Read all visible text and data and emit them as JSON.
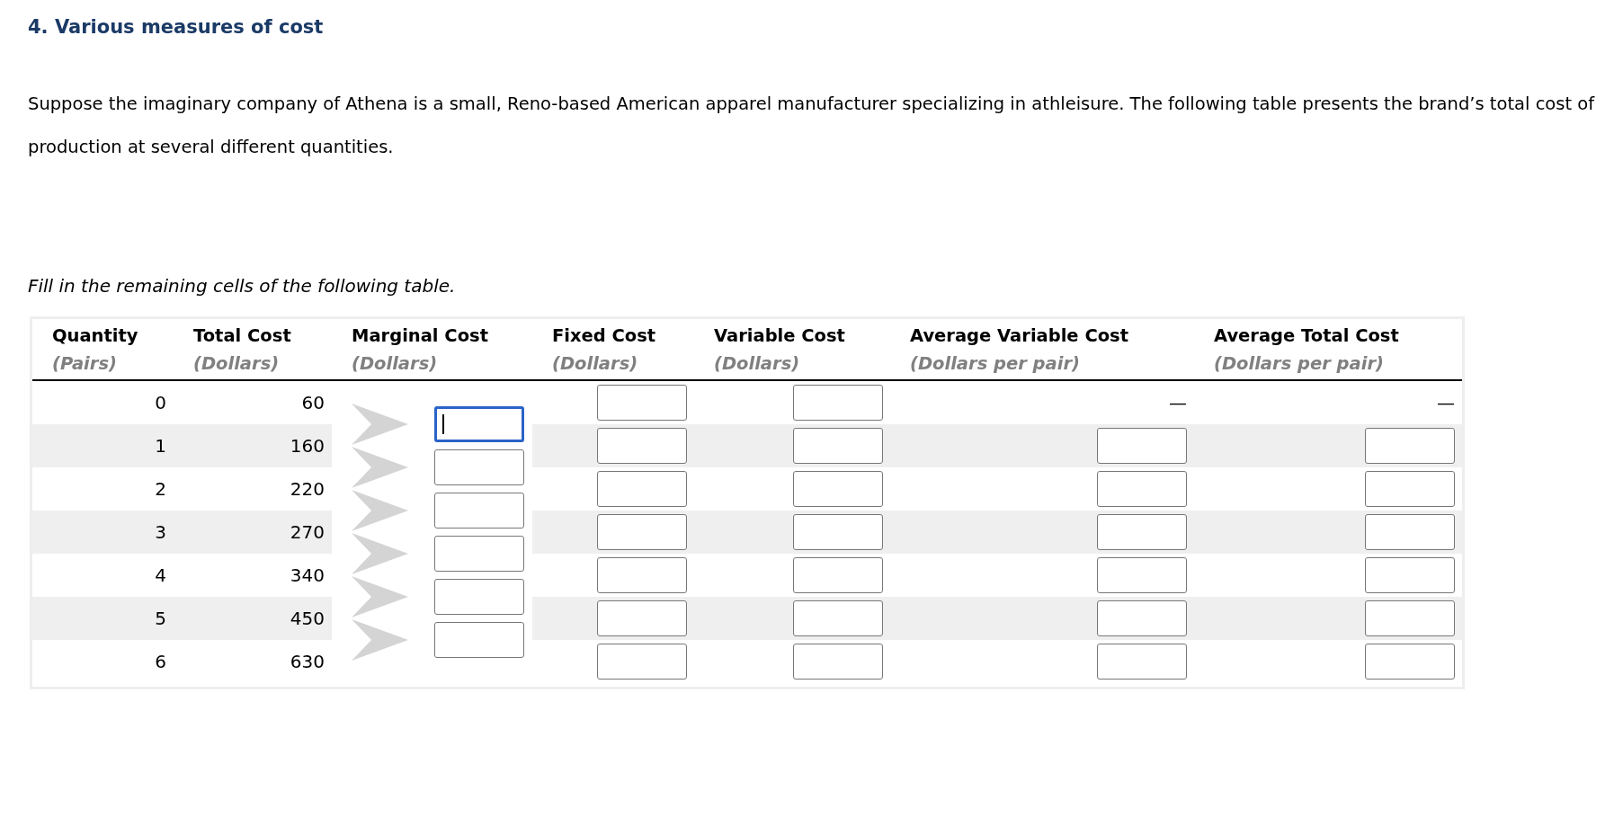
{
  "title": "4. Various measures of cost",
  "intro": "Suppose the imaginary company of Athena is a small, Reno-based American apparel manufacturer specializing in athleisure. The following table presents the brand’s total cost of production at several different quantities.",
  "instruction": "Fill in the remaining cells of the following table.",
  "table": {
    "columns": [
      {
        "title": "Quantity",
        "unit": "(Pairs)"
      },
      {
        "title": "Total Cost",
        "unit": "(Dollars)"
      },
      {
        "title": "Marginal Cost",
        "unit": "(Dollars)"
      },
      {
        "title": "Fixed Cost",
        "unit": "(Dollars)"
      },
      {
        "title": "Variable Cost",
        "unit": "(Dollars)"
      },
      {
        "title": "Average Variable Cost",
        "unit": "(Dollars per pair)"
      },
      {
        "title": "Average Total Cost",
        "unit": "(Dollars per pair)"
      }
    ],
    "rows": [
      {
        "quantity": "0",
        "total_cost": "60",
        "cells": [
          {
            "kind": "input"
          },
          {
            "kind": "input"
          },
          {
            "kind": "text",
            "value": "—"
          },
          {
            "kind": "text",
            "value": "—"
          }
        ]
      },
      {
        "quantity": "1",
        "total_cost": "160",
        "cells": [
          {
            "kind": "input"
          },
          {
            "kind": "input"
          },
          {
            "kind": "input"
          },
          {
            "kind": "input"
          }
        ]
      },
      {
        "quantity": "2",
        "total_cost": "220",
        "cells": [
          {
            "kind": "input"
          },
          {
            "kind": "input"
          },
          {
            "kind": "input"
          },
          {
            "kind": "input"
          }
        ]
      },
      {
        "quantity": "3",
        "total_cost": "270",
        "cells": [
          {
            "kind": "input"
          },
          {
            "kind": "input"
          },
          {
            "kind": "input"
          },
          {
            "kind": "input"
          }
        ]
      },
      {
        "quantity": "4",
        "total_cost": "340",
        "cells": [
          {
            "kind": "input"
          },
          {
            "kind": "input"
          },
          {
            "kind": "input"
          },
          {
            "kind": "input"
          }
        ]
      },
      {
        "quantity": "5",
        "total_cost": "450",
        "cells": [
          {
            "kind": "input"
          },
          {
            "kind": "input"
          },
          {
            "kind": "input"
          },
          {
            "kind": "input"
          }
        ]
      },
      {
        "quantity": "6",
        "total_cost": "630",
        "cells": [
          {
            "kind": "input"
          },
          {
            "kind": "input"
          },
          {
            "kind": "input"
          },
          {
            "kind": "input"
          }
        ]
      }
    ],
    "marginal_cost_fields": [
      {
        "focused": true
      },
      {
        "focused": false
      },
      {
        "focused": false
      },
      {
        "focused": false
      },
      {
        "focused": false
      },
      {
        "focused": false
      }
    ]
  }
}
